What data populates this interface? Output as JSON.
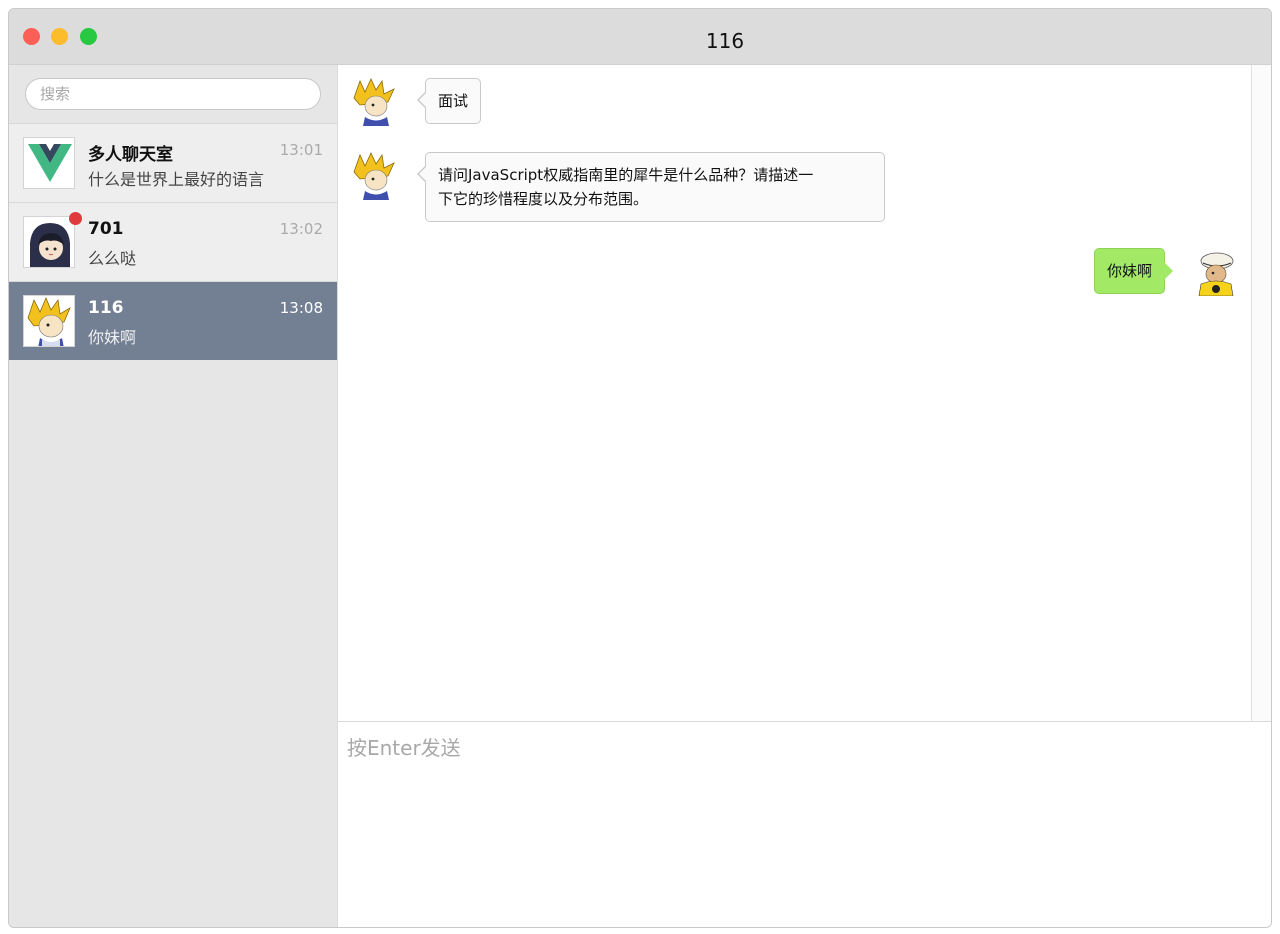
{
  "window": {
    "title": "116"
  },
  "search": {
    "placeholder": "搜索"
  },
  "conversations": [
    {
      "name": "多人聊天室",
      "time": "13:01",
      "preview": "什么是世界上最好的语言",
      "avatar": "vue-logo-icon",
      "unread": false,
      "active": false
    },
    {
      "name": "701",
      "time": "13:02",
      "preview": "么么哒",
      "avatar": "hooded-girl-avatar",
      "unread": true,
      "active": false
    },
    {
      "name": "116",
      "time": "13:08",
      "preview": "你妹啊",
      "avatar": "spiky-hair-avatar",
      "unread": false,
      "active": true
    }
  ],
  "messages": [
    {
      "from": "other",
      "text": "面试",
      "avatar": "spiky-hair-avatar"
    },
    {
      "from": "other",
      "text_lines": [
        "请问JavaScript权威指南里的犀牛是什么品种？请描述一",
        "下它的珍惜程度以及分布范围。"
      ],
      "avatar": "spiky-hair-avatar"
    },
    {
      "from": "self",
      "text": "你妹啊",
      "avatar": "straw-hat-avatar"
    }
  ],
  "composer": {
    "placeholder": "按Enter发送"
  },
  "colors": {
    "active_conversation": "#737f93",
    "self_bubble": "#a2ea66",
    "unread_badge": "#e0393e",
    "traffic_red": "#fc5f57",
    "traffic_yellow": "#fdbc2e",
    "traffic_green": "#28c840"
  }
}
